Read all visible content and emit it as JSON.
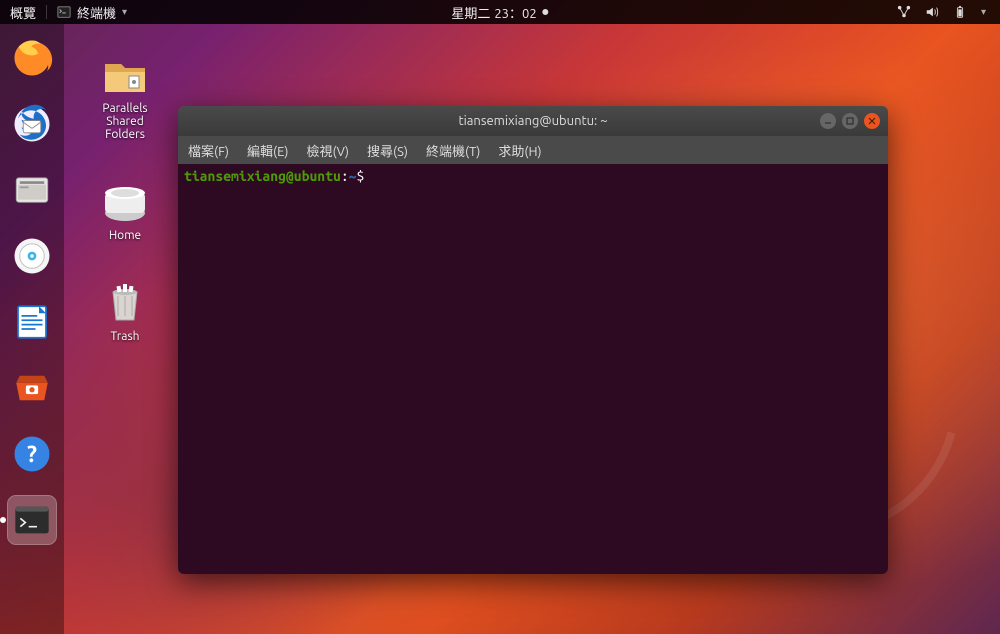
{
  "topbar": {
    "overview": "概覽",
    "active_app": "終端機",
    "date": "星期二",
    "time": "23：02"
  },
  "desktop": {
    "icons": [
      {
        "name": "parallels-folder",
        "label": "Parallels\nShared\nFolders"
      },
      {
        "name": "home-folder",
        "label": "Home"
      },
      {
        "name": "trash",
        "label": "Trash"
      }
    ]
  },
  "terminal": {
    "title": "tiansemixiang@ubuntu: ~",
    "menu": {
      "file": "檔案(F)",
      "edit": "編輯(E)",
      "view": "檢視(V)",
      "search": "搜尋(S)",
      "terminal": "終端機(T)",
      "help": "求助(H)"
    },
    "prompt": {
      "userhost": "tiansemixiang@ubuntu",
      "colon": ":",
      "path": "~",
      "symbol": "$"
    }
  }
}
